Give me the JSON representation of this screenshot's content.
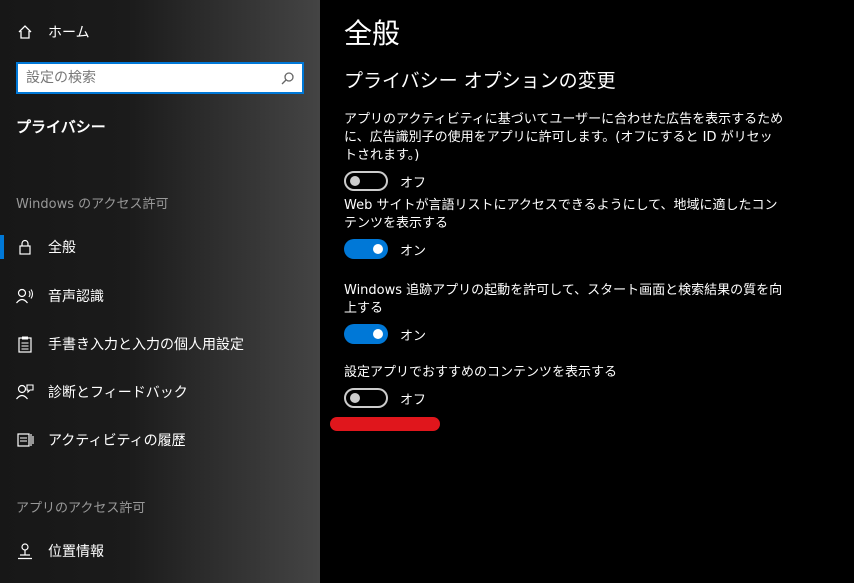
{
  "sidebar": {
    "home_label": "ホーム",
    "search_placeholder": "設定の検索",
    "section_title": "プライバシー",
    "group_windows": "Windows のアクセス許可",
    "windows_items": [
      {
        "label": "全般",
        "icon": "lock-icon",
        "selected": true
      },
      {
        "label": "音声認識",
        "icon": "speech-icon",
        "selected": false
      },
      {
        "label": "手書き入力と入力の個人用設定",
        "icon": "clipboard-icon",
        "selected": false
      },
      {
        "label": "診断とフィードバック",
        "icon": "feedback-icon",
        "selected": false
      },
      {
        "label": "アクティビティの履歴",
        "icon": "activity-icon",
        "selected": false
      }
    ],
    "group_apps": "アプリのアクセス許可",
    "app_items": [
      {
        "label": "位置情報",
        "icon": "location-icon"
      }
    ]
  },
  "main": {
    "title": "全般",
    "subtitle": "プライバシー オプションの変更",
    "settings": [
      {
        "desc": "アプリのアクティビティに基づいてユーザーに合わせた広告を表示するために、広告識別子の使用をアプリに許可します。(オフにすると ID がリセットされます。)",
        "state": "オフ",
        "on": false
      },
      {
        "desc": "Web サイトが言語リストにアクセスできるようにして、地域に適したコンテンツを表示する",
        "state": "オン",
        "on": true
      },
      {
        "desc": "Windows 追跡アプリの起動を許可して、スタート画面と検索結果の質を向上する",
        "state": "オン",
        "on": true
      },
      {
        "desc": "設定アプリでおすすめのコンテンツを表示する",
        "state": "オフ",
        "on": false
      }
    ]
  },
  "colors": {
    "accent": "#0078d7",
    "highlight_mark": "#e0161c"
  }
}
